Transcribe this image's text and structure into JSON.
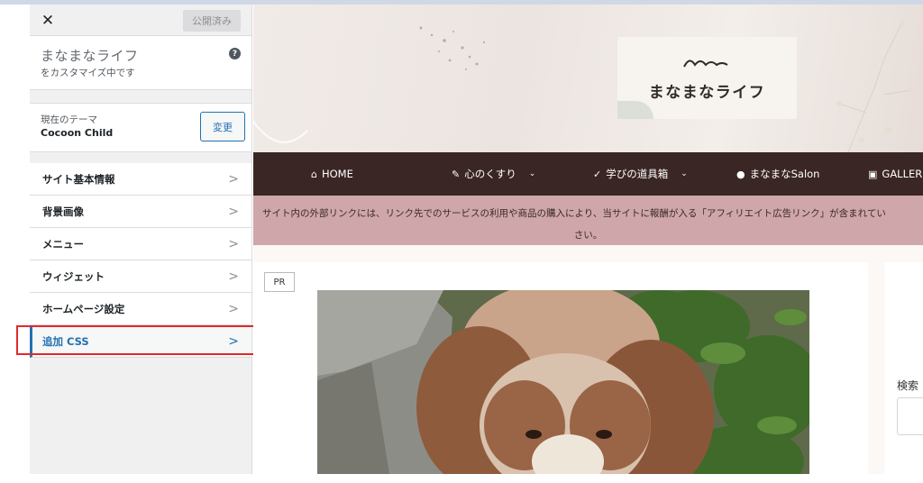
{
  "panel": {
    "close_icon": "close-icon",
    "publish_label": "公開済み",
    "site_title": "まなまなライフ",
    "customizing_text": "をカスタマイズ中です",
    "help_icon_glyph": "?",
    "theme_label": "現在のテーマ",
    "theme_name": "Cocoon Child",
    "change_label": "変更",
    "sections": [
      {
        "label": "サイト基本情報"
      },
      {
        "label": "背景画像"
      },
      {
        "label": "メニュー"
      },
      {
        "label": "ウィジェット"
      },
      {
        "label": "ホームページ設定"
      },
      {
        "label": "追加 CSS",
        "active": true
      }
    ],
    "highlight_color": "#e02a2a"
  },
  "preview": {
    "logo_text": "まなまなライフ",
    "nav": [
      {
        "icon": "home-icon",
        "label": "HOME"
      },
      {
        "icon": "magic-wand-icon",
        "label": "心のくすり",
        "dropdown": true
      },
      {
        "icon": "wrench-icon",
        "label": "学びの道具箱",
        "dropdown": true
      },
      {
        "icon": "users-icon",
        "label": "まなまなSalon"
      },
      {
        "icon": "image-icon",
        "label": "GALLER"
      }
    ],
    "notice_line1": "サイト内の外部リンクには、リンク先でのサービスの利用や商品の購入により、当サイトに報酬が入る「アフィリエイト広告リンク」が含まれてい",
    "notice_line2": "さい。",
    "pr_badge": "PR",
    "search_label": "検索",
    "colors": {
      "nav_bg": "#3a2624",
      "notice_bg": "#cfa6a9",
      "accent": "#2271b1"
    }
  }
}
